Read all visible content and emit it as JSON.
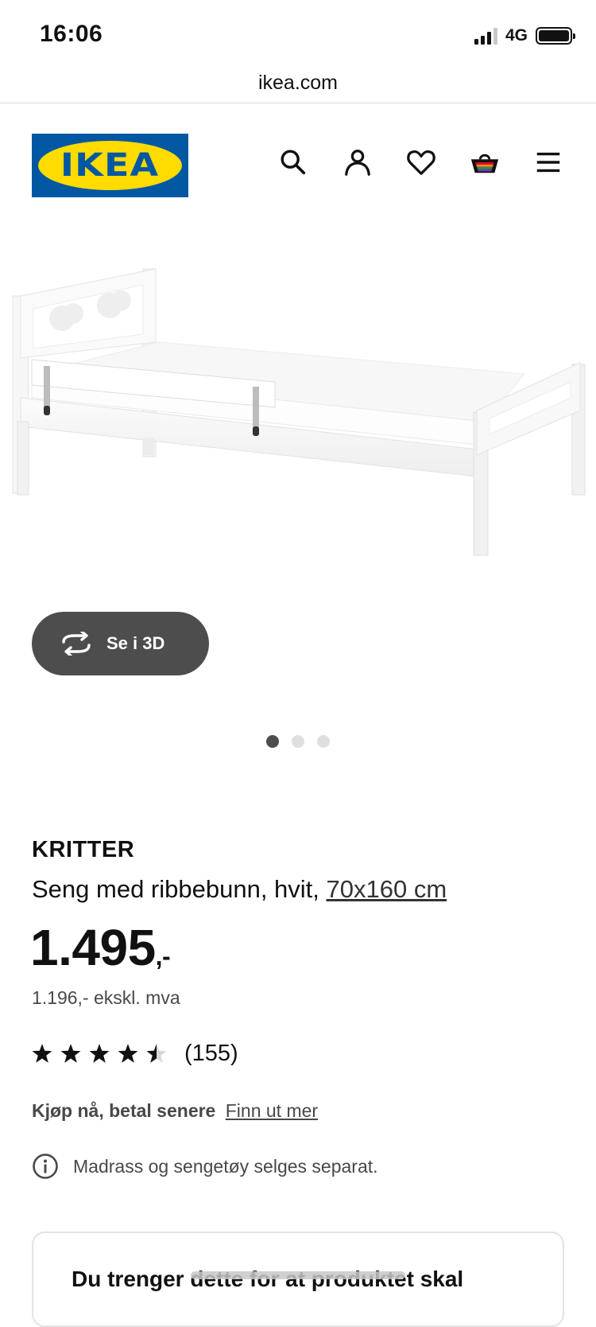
{
  "status_bar": {
    "time": "16:06",
    "network": "4G",
    "battery_level": 1.0
  },
  "browser": {
    "url": "ikea.com"
  },
  "header": {
    "logo_text": "IKEA",
    "brand_colors": {
      "blue": "#0058a3",
      "yellow": "#ffdb00"
    },
    "icons": [
      "search-icon",
      "account-icon",
      "heart-icon",
      "cart-icon",
      "menu-icon"
    ]
  },
  "gallery": {
    "view_3d_label": "Se i 3D",
    "image_count": 3,
    "active_index": 0
  },
  "product": {
    "name": "KRITTER",
    "description": "Seng med ribbebunn, hvit,",
    "size": "70x160 cm",
    "price": "1.495",
    "price_suffix": ",-",
    "price_ex_vat": "1.196,- ekskl. mva",
    "rating": 4.5,
    "rating_max": 5,
    "review_count": "(155)"
  },
  "payment": {
    "label": "Kjøp nå, betal senere",
    "link": "Finn ut mer"
  },
  "notice": {
    "text": "Madrass og sengetøy selges separat."
  },
  "card": {
    "title": "Du trenger dette for at produktet skal"
  }
}
